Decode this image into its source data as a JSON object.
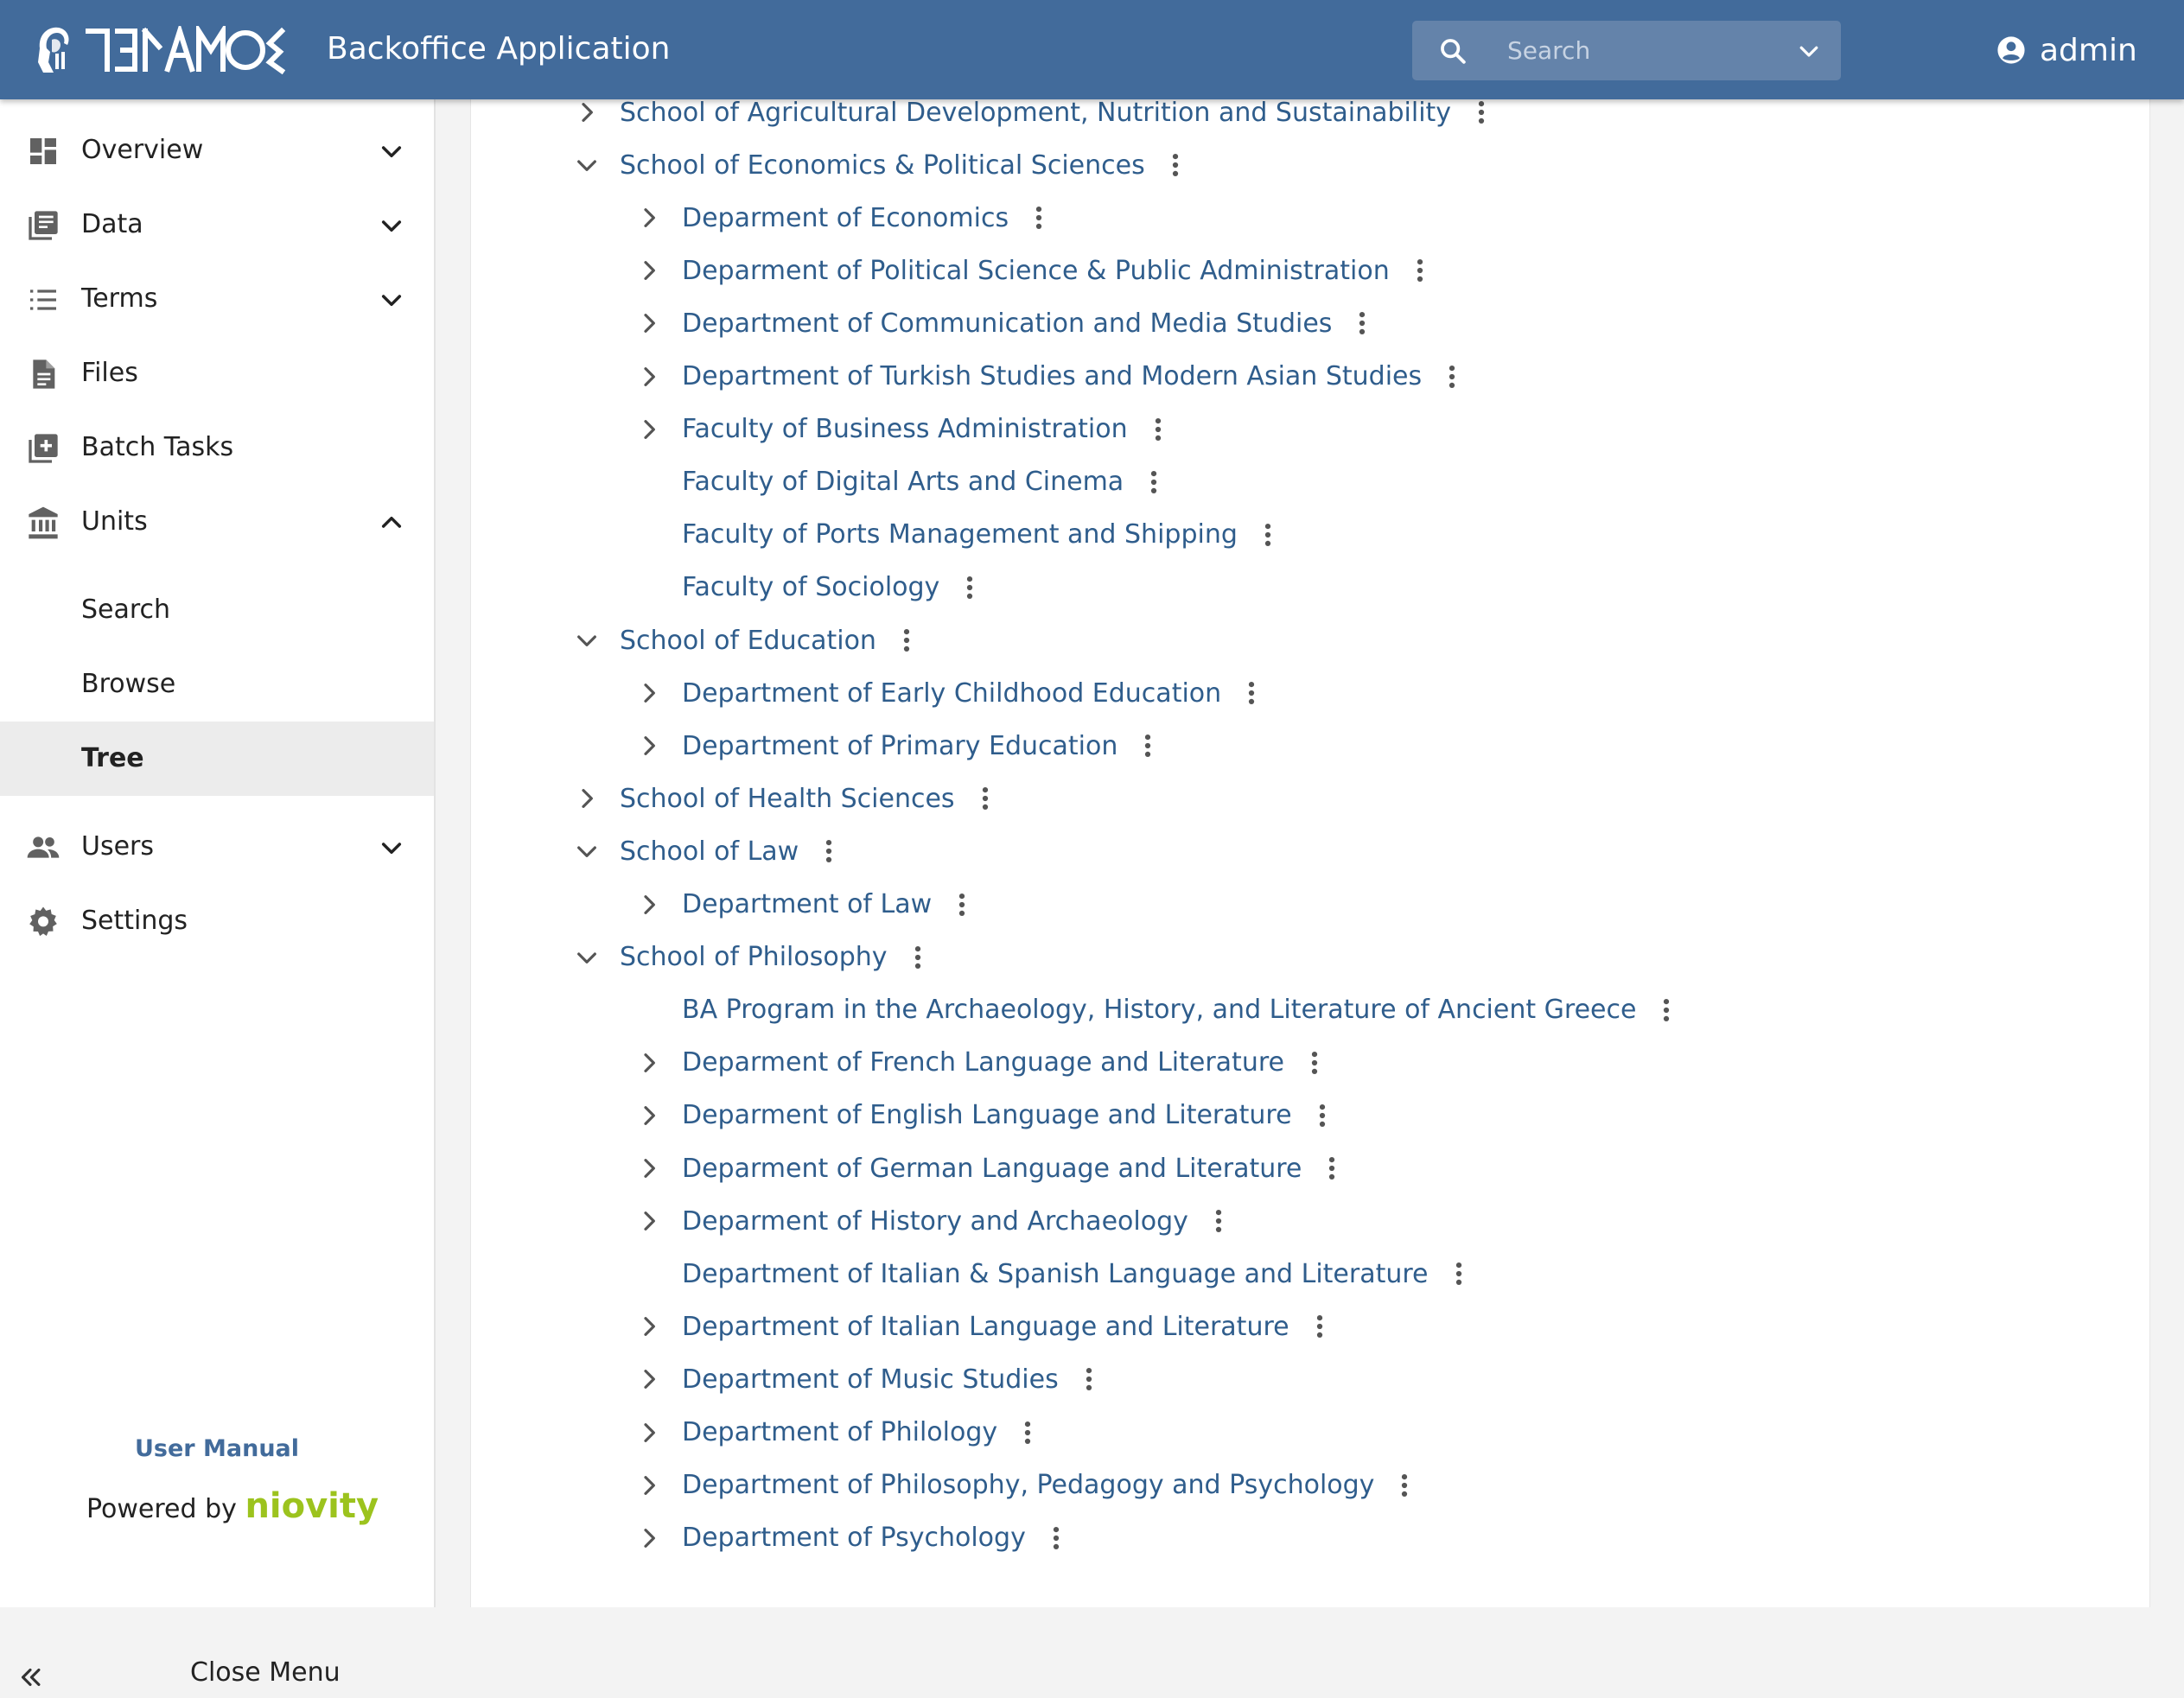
{
  "header": {
    "logo_text": "ΤΕΙΡΑΜΟΣ",
    "app_title": "Backoffice Application",
    "search_placeholder": "Search",
    "user_name": "admin"
  },
  "sidebar": {
    "items": [
      {
        "label": "Overview",
        "icon": "dashboard-icon",
        "chevron": "down"
      },
      {
        "label": "Data",
        "icon": "library-books-icon",
        "chevron": "down"
      },
      {
        "label": "Terms",
        "icon": "list-icon",
        "chevron": "down"
      },
      {
        "label": "Files",
        "icon": "file-icon",
        "chevron": ""
      },
      {
        "label": "Batch Tasks",
        "icon": "add-box-icon",
        "chevron": ""
      },
      {
        "label": "Units",
        "icon": "institution-icon",
        "chevron": "up"
      }
    ],
    "units_sub": [
      {
        "label": "Search",
        "active": false
      },
      {
        "label": "Browse",
        "active": false
      },
      {
        "label": "Tree",
        "active": true
      }
    ],
    "items_after": [
      {
        "label": "Users",
        "icon": "people-icon",
        "chevron": "down"
      },
      {
        "label": "Settings",
        "icon": "gear-icon",
        "chevron": ""
      }
    ],
    "user_manual": "User Manual",
    "powered_by": "Powered by",
    "brand": "niovity",
    "close_menu": "Close Menu"
  },
  "tree": [
    {
      "label": "School of Agricultural Development, Nutrition and Sustainability",
      "level": 0,
      "toggle": "collapsed"
    },
    {
      "label": "School of Economics & Political Sciences",
      "level": 0,
      "toggle": "expanded"
    },
    {
      "label": "Deparment of Economics",
      "level": 1,
      "toggle": "collapsed"
    },
    {
      "label": "Deparment of Political Science & Public Administration",
      "level": 1,
      "toggle": "collapsed"
    },
    {
      "label": "Department of Communication and Media Studies",
      "level": 1,
      "toggle": "collapsed"
    },
    {
      "label": "Department of Turkish Studies and Modern Asian Studies",
      "level": 1,
      "toggle": "collapsed"
    },
    {
      "label": "Faculty of Business Administration",
      "level": 1,
      "toggle": "collapsed"
    },
    {
      "label": "Faculty of Digital Arts and Cinema",
      "level": 1,
      "toggle": "none"
    },
    {
      "label": "Faculty of Ports Management and Shipping",
      "level": 1,
      "toggle": "none"
    },
    {
      "label": "Faculty of Sociology",
      "level": 1,
      "toggle": "none"
    },
    {
      "label": "School of Education",
      "level": 0,
      "toggle": "expanded"
    },
    {
      "label": "Department of Early Childhood Education",
      "level": 1,
      "toggle": "collapsed"
    },
    {
      "label": "Department of Primary Education",
      "level": 1,
      "toggle": "collapsed"
    },
    {
      "label": "School of Health Sciences",
      "level": 0,
      "toggle": "collapsed"
    },
    {
      "label": "School of Law",
      "level": 0,
      "toggle": "expanded"
    },
    {
      "label": "Department of Law",
      "level": 1,
      "toggle": "collapsed"
    },
    {
      "label": "School of Philosophy",
      "level": 0,
      "toggle": "expanded"
    },
    {
      "label": "BA Program in the Archaeology, History, and Literature of Ancient Greece",
      "level": 1,
      "toggle": "none"
    },
    {
      "label": "Deparment of French Language and Literature",
      "level": 1,
      "toggle": "collapsed"
    },
    {
      "label": "Deparment of English Language and Literature",
      "level": 1,
      "toggle": "collapsed"
    },
    {
      "label": "Deparment of German Language and Literature",
      "level": 1,
      "toggle": "collapsed"
    },
    {
      "label": "Deparment of History and Archaeology",
      "level": 1,
      "toggle": "collapsed"
    },
    {
      "label": "Department of Italian & Spanish Language and Literature",
      "level": 1,
      "toggle": "none"
    },
    {
      "label": "Department of Italian Language and Literature",
      "level": 1,
      "toggle": "collapsed"
    },
    {
      "label": "Department of Music Studies",
      "level": 1,
      "toggle": "collapsed"
    },
    {
      "label": "Department of Philology",
      "level": 1,
      "toggle": "collapsed"
    },
    {
      "label": "Department of Philosophy, Pedagogy and Psychology",
      "level": 1,
      "toggle": "collapsed"
    },
    {
      "label": "Department of Psychology",
      "level": 1,
      "toggle": "collapsed"
    }
  ]
}
